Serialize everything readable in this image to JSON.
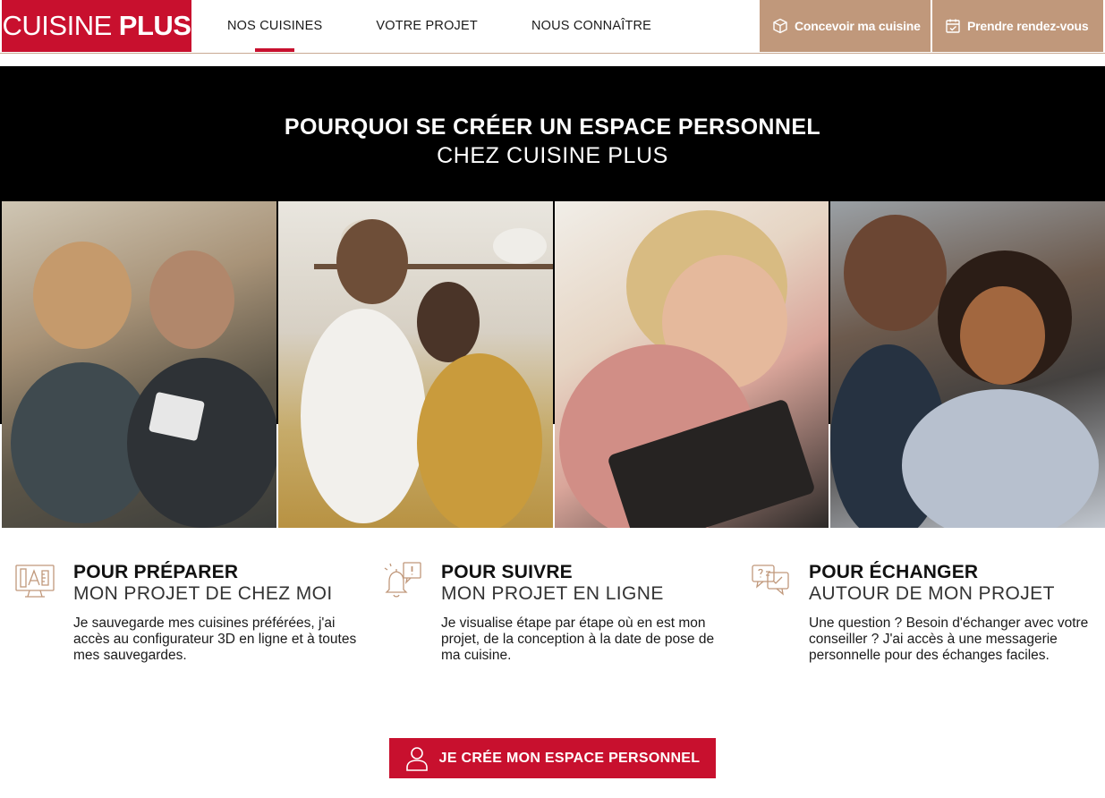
{
  "brand": {
    "name_light": "CUISINE",
    "name_bold": "PLUS",
    "color": "#c8102e"
  },
  "nav": {
    "items": [
      {
        "label": "NOS CUISINES",
        "active": true
      },
      {
        "label": "VOTRE PROJET",
        "active": false
      },
      {
        "label": "NOUS CONNAÎTRE",
        "active": false
      }
    ]
  },
  "actions": {
    "design": {
      "label": "Concevoir ma cuisine",
      "icon": "cube-icon"
    },
    "appointment": {
      "label": "Prendre rendez-vous",
      "icon": "calendar-check-icon"
    },
    "accent": "#c0987b"
  },
  "hero": {
    "title_line1": "POURQUOI SE CRÉER UN ESPACE PERSONNEL",
    "title_line2": "CHEZ CUISINE PLUS"
  },
  "features": [
    {
      "icon": "computer-design-icon",
      "title": "POUR PRÉPARER",
      "subtitle": "MON PROJET DE CHEZ MOI",
      "description": "Je sauvegarde mes cuisines préférées, j'ai accès au configurateur 3D en ligne et à toutes mes sauvegardes."
    },
    {
      "icon": "notification-bell-icon",
      "title": "POUR SUIVRE",
      "subtitle": "MON PROJET EN LIGNE",
      "description": "Je visualise étape par étape où en est mon projet, de la conception à la date de pose de ma cuisine."
    },
    {
      "icon": "chat-bubbles-icon",
      "title": "POUR ÉCHANGER",
      "subtitle": "AUTOUR DE MON PROJET",
      "description": "Une question ? Besoin d'échanger avec votre conseiller ? J'ai accès à une messagerie personnelle pour des échanges faciles."
    }
  ],
  "cta": {
    "label": "JE CRÉE MON ESPACE PERSONNEL",
    "icon": "user-icon"
  }
}
